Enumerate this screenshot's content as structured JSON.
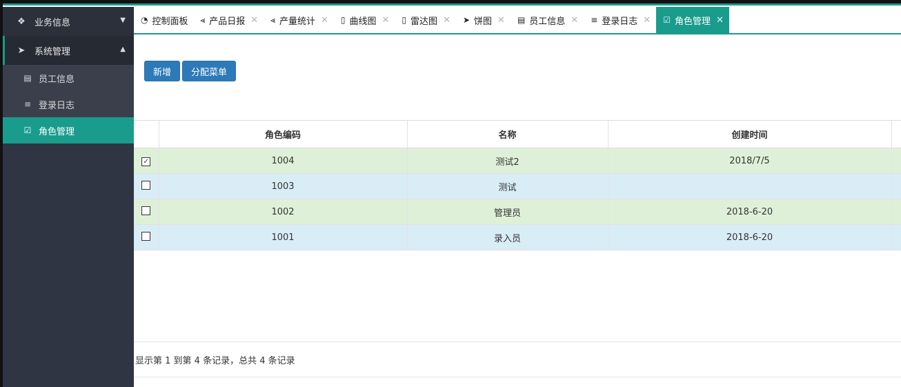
{
  "sidebar": {
    "groups": [
      {
        "label": "业务信息",
        "icon": "cubes-icon",
        "open": false
      },
      {
        "label": "系统管理",
        "icon": "paper-plane-icon",
        "open": true
      }
    ],
    "items": [
      {
        "label": "员工信息",
        "icon": "calendar-icon"
      },
      {
        "label": "登录日志",
        "icon": "bars-icon"
      },
      {
        "label": "角色管理",
        "icon": "check-square-icon",
        "active": true
      }
    ]
  },
  "tabs": [
    {
      "label": "控制面板",
      "icon": "dashboard-icon",
      "closable": false
    },
    {
      "label": "产品日报",
      "icon": "share-icon",
      "closable": true
    },
    {
      "label": "产量统计",
      "icon": "share-icon",
      "closable": true
    },
    {
      "label": "曲线图",
      "icon": "file-icon",
      "closable": true
    },
    {
      "label": "雷达图",
      "icon": "file-icon",
      "closable": true
    },
    {
      "label": "饼图",
      "icon": "paper-plane-icon",
      "closable": true
    },
    {
      "label": "员工信息",
      "icon": "calendar-icon",
      "closable": true
    },
    {
      "label": "登录日志",
      "icon": "bars-icon",
      "closable": true
    },
    {
      "label": "角色管理",
      "icon": "check-square-icon",
      "closable": true,
      "active": true
    }
  ],
  "toolbar": {
    "add_label": "新增",
    "assign_label": "分配菜单"
  },
  "table": {
    "columns": [
      "角色编码",
      "名称",
      "创建时间"
    ],
    "rows": [
      {
        "checked": true,
        "code": "1004",
        "name": "测试2",
        "created": "2018/7/5"
      },
      {
        "checked": false,
        "code": "1003",
        "name": "测试",
        "created": ""
      },
      {
        "checked": false,
        "code": "1002",
        "name": "管理员",
        "created": "2018-6-20"
      },
      {
        "checked": false,
        "code": "1001",
        "name": "录入员",
        "created": "2018-6-20"
      }
    ]
  },
  "pagination": {
    "summary": "显示第 1 到第 4 条记录，总共 4 条记录"
  },
  "colors": {
    "accent": "#1a9c8d",
    "sidebar_bg": "#2f3542",
    "button": "#2d7ab8",
    "row_green": "#dff0d8",
    "row_blue": "#d9edf7"
  }
}
